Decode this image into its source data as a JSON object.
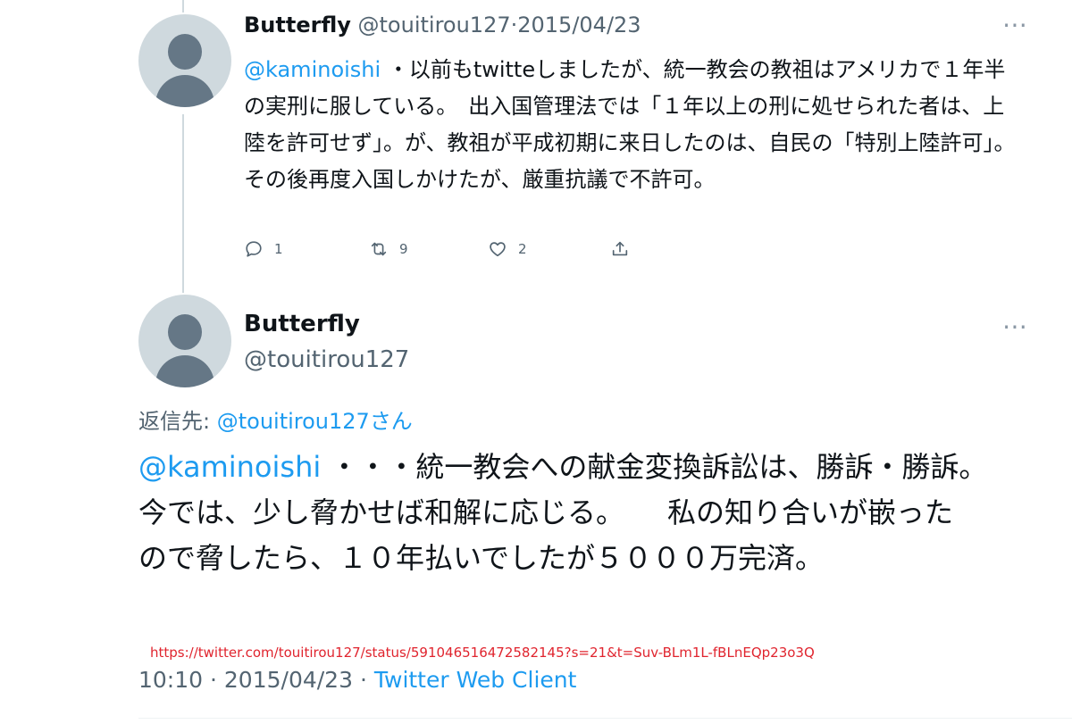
{
  "tweet1": {
    "display_name": "Butterfly",
    "handle": "@touitirou127",
    "separator": "·",
    "date": "2015/04/23",
    "mention": "@kaminoishi",
    "body_rest": " ・以前もtwitteしましたが、統一教会の教祖はアメリカで１年半の実刑に服している。　出入国管理法では「１年以上の刑に処せられた者は、上陸を許可せず」。が、教祖が平成初期に来日したのは、自民の「特別上陸許可」。\nその後再度入国しかけたが、厳重抗議で不許可。",
    "more_icon": "⋯",
    "reply_count": "1",
    "retweet_count": "9",
    "like_count": "2"
  },
  "tweet2": {
    "display_name": "Butterfly",
    "handle": "@touitirou127",
    "reply_prefix": "返信先: ",
    "reply_handle": "@touitirou127",
    "reply_suffix": "さん",
    "mention": "@kaminoishi",
    "body_rest": "・・・統一教会への献金変換訴訟は、勝訴・勝訴。　今では、少し脅かせば和解に応じる。　　私の知り合いが嵌ったので脅したら、１０年払いでしたが５０００万完済。",
    "more_icon": "⋯",
    "url": "https://twitter.com/touitirou127/status/591046516472582145?s=21&t=Suv-BLm1L-fBLnEQp23o3Q",
    "time": "10:10",
    "separator": "·",
    "date": "2015/04/23",
    "separator2": "·",
    "client": "Twitter Web Client"
  },
  "colors": {
    "link": "#1d9bf0",
    "secondary_text": "#536471",
    "url_annotation": "#e0242e",
    "avatar_bg": "#cfd9de"
  }
}
